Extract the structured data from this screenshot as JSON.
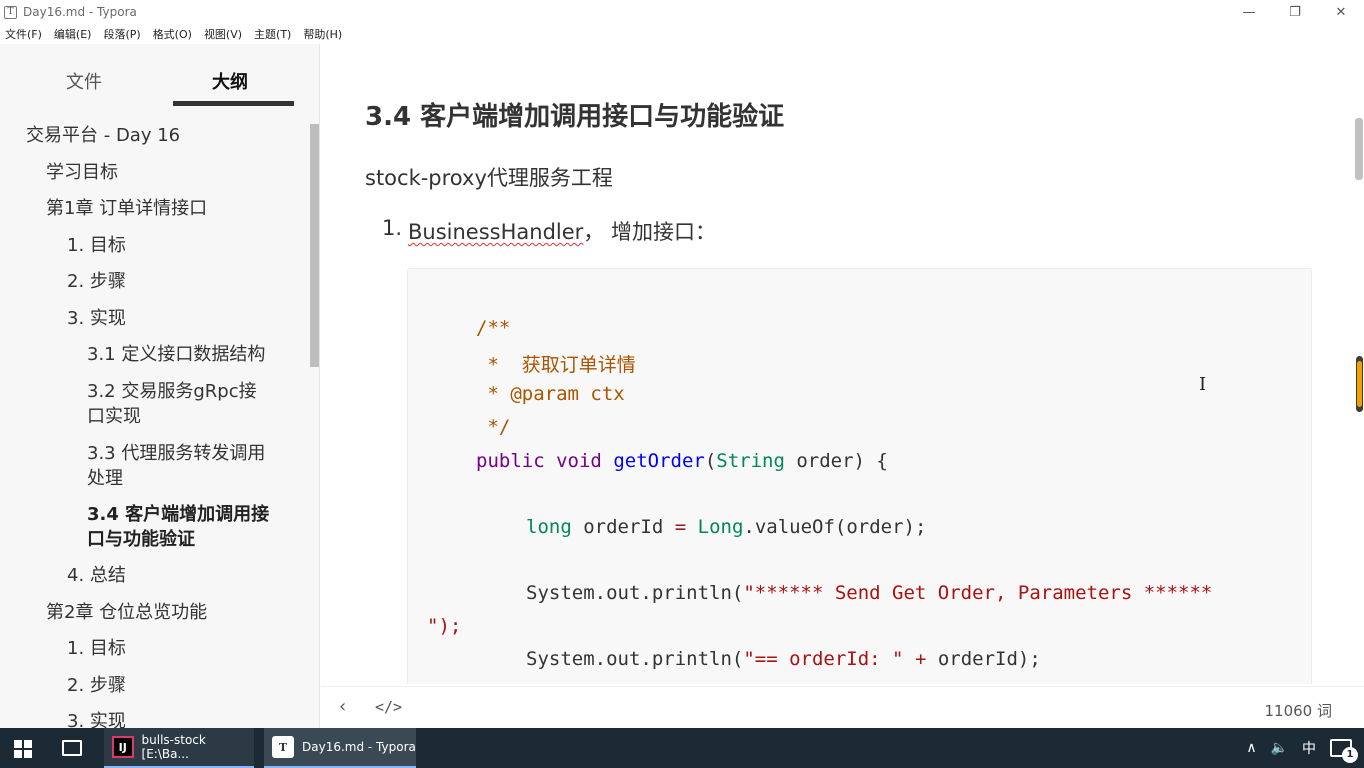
{
  "window": {
    "title": "Day16.md - Typora",
    "app_icon": "T",
    "controls": {
      "minimize": "—",
      "restore": "❐",
      "close": "✕"
    }
  },
  "menu": [
    "文件(F)",
    "编辑(E)",
    "段落(P)",
    "格式(O)",
    "视图(V)",
    "主题(T)",
    "帮助(H)"
  ],
  "sidebar": {
    "tabs": {
      "files": "文件",
      "outline": "大纲"
    },
    "outline": [
      "交易平台 - Day 16",
      "学习目标",
      "第1章 订单详情接口",
      "1. 目标",
      "2. 步骤",
      "3. 实现",
      "3.1 定义接口数据结构",
      "3.2 交易服务gRpc接",
      "口实现",
      "3.3 代理服务转发调用",
      "处理",
      "3.4 客户端增加调用接",
      "口与功能验证",
      "4. 总结",
      "第2章 仓位总览功能",
      "1. 目标",
      "2. 步骤",
      "3. 实现"
    ]
  },
  "editor": {
    "heading": "3.4  客户端增加调用接口与功能验证",
    "paragraph": "stock-proxy代理服务工程",
    "list_item": {
      "number": "1.",
      "code_name": "BusinessHandler",
      "text": "， 增加接口："
    },
    "code": {
      "comment_open": "/**",
      "comment_line1": " *  获取订单详情",
      "comment_line2": " * @param ctx",
      "comment_close": " */",
      "sig_public": "public",
      "sig_void": "void",
      "sig_fn": "getOrder",
      "sig_paren_open": "(",
      "sig_type": "String",
      "sig_rest": " order) {",
      "l2_type": "long",
      "l2_mid": " orderId ",
      "l2_eq": "=",
      "l2_cls": "Long",
      "l2_rest": ".valueOf(order);",
      "l3_pre": "System.out.println(",
      "l3_str": "\"****** Send Get Order, Parameters ******",
      "l3_cont": "\");",
      "l4_pre": "System.out.println(",
      "l4_str": "\"== orderId: \"",
      "l4_op": " + ",
      "l4_rest": "orderId);"
    }
  },
  "footer": {
    "back_icon": "‹",
    "source_icon": "</>",
    "word_count": "11060 词"
  },
  "taskbar": {
    "idea_label": "bulls-stock [E:\\Ba...",
    "idea_icon": "IJ",
    "typora_label": "Day16.md - Typora",
    "typora_icon": "T",
    "tray_up": "∧",
    "volume": "🔈",
    "ime": "中",
    "notification_count": "1"
  },
  "colors": {
    "comment": "#aa5500",
    "keyword": "#770088",
    "function": "#0000ff",
    "type": "#008855",
    "string": "#aa1111"
  }
}
